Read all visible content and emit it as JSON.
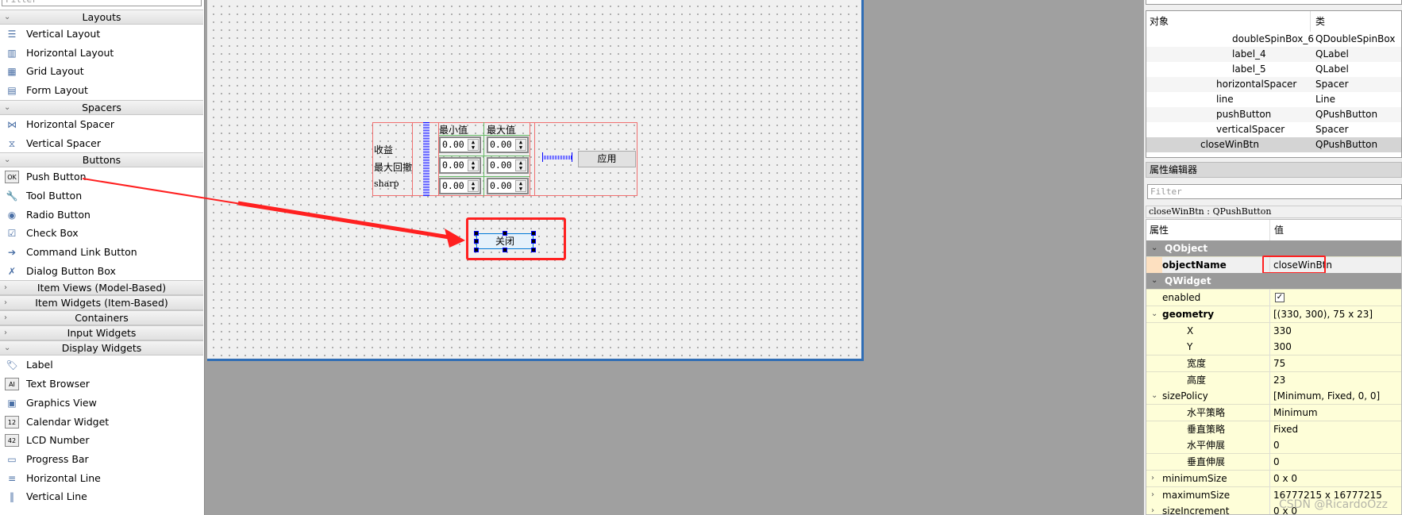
{
  "widget_box": {
    "filter_placeholder": "Filter",
    "categories": [
      {
        "label": "Layouts",
        "expanded": true,
        "items": [
          {
            "label": "Vertical Layout",
            "icon": "vertical-layout-icon"
          },
          {
            "label": "Horizontal Layout",
            "icon": "horizontal-layout-icon"
          },
          {
            "label": "Grid Layout",
            "icon": "grid-layout-icon"
          },
          {
            "label": "Form Layout",
            "icon": "form-layout-icon"
          }
        ]
      },
      {
        "label": "Spacers",
        "expanded": true,
        "items": [
          {
            "label": "Horizontal Spacer",
            "icon": "horizontal-spacer-icon"
          },
          {
            "label": "Vertical Spacer",
            "icon": "vertical-spacer-icon"
          }
        ]
      },
      {
        "label": "Buttons",
        "expanded": true,
        "items": [
          {
            "label": "Push Button",
            "icon": "push-button-icon",
            "glyph": "OK"
          },
          {
            "label": "Tool Button",
            "icon": "tool-button-icon"
          },
          {
            "label": "Radio Button",
            "icon": "radio-button-icon"
          },
          {
            "label": "Check Box",
            "icon": "check-box-icon"
          },
          {
            "label": "Command Link Button",
            "icon": "command-link-icon"
          },
          {
            "label": "Dialog Button Box",
            "icon": "dialog-button-box-icon"
          }
        ]
      },
      {
        "label": "Item Views (Model-Based)",
        "expanded": false,
        "items": []
      },
      {
        "label": "Item Widgets (Item-Based)",
        "expanded": false,
        "items": []
      },
      {
        "label": "Containers",
        "expanded": false,
        "items": []
      },
      {
        "label": "Input Widgets",
        "expanded": false,
        "items": []
      },
      {
        "label": "Display Widgets",
        "expanded": true,
        "items": [
          {
            "label": "Label",
            "icon": "label-icon"
          },
          {
            "label": "Text Browser",
            "icon": "text-browser-icon",
            "glyph": "AI"
          },
          {
            "label": "Graphics View",
            "icon": "graphics-view-icon"
          },
          {
            "label": "Calendar Widget",
            "icon": "calendar-icon",
            "glyph": "12"
          },
          {
            "label": "LCD Number",
            "icon": "lcd-number-icon",
            "glyph": "42"
          },
          {
            "label": "Progress Bar",
            "icon": "progress-bar-icon"
          },
          {
            "label": "Horizontal Line",
            "icon": "horizontal-line-icon"
          },
          {
            "label": "Vertical Line",
            "icon": "vertical-line-icon"
          }
        ]
      }
    ]
  },
  "form": {
    "row_labels": [
      "收益",
      "最大回撤",
      "sharp"
    ],
    "col_headers": [
      "最小值",
      "最大值"
    ],
    "spin_values": [
      [
        "0.00",
        "0.00"
      ],
      [
        "0.00",
        "0.00"
      ],
      [
        "0.00",
        "0.00"
      ]
    ],
    "apply_button": "应用",
    "close_button": "关闭"
  },
  "object_inspector": {
    "headers": [
      "对象",
      "类"
    ],
    "rows": [
      {
        "name": "doubleSpinBox_6",
        "class": "QDoubleSpinBox",
        "level": 3
      },
      {
        "name": "label_4",
        "class": "QLabel",
        "level": 3
      },
      {
        "name": "label_5",
        "class": "QLabel",
        "level": 3
      },
      {
        "name": "horizontalSpacer",
        "class": "Spacer",
        "level": 2
      },
      {
        "name": "line",
        "class": "Line",
        "level": 2
      },
      {
        "name": "pushButton",
        "class": "QPushButton",
        "level": 2
      },
      {
        "name": "verticalSpacer",
        "class": "Spacer",
        "level": 2
      },
      {
        "name": "closeWinBtn",
        "class": "QPushButton",
        "level": 1,
        "selected": true
      }
    ]
  },
  "property_editor": {
    "title": "属性编辑器",
    "filter_placeholder": "Filter",
    "object_label": "closeWinBtn : QPushButton",
    "headers": [
      "属性",
      "值"
    ],
    "rows": [
      {
        "type": "group",
        "key": "QObject"
      },
      {
        "key": "objectName",
        "value": "closeWinBtn",
        "bold": true,
        "level": 0,
        "highlight": true
      },
      {
        "type": "group",
        "key": "QWidget"
      },
      {
        "key": "enabled",
        "value": "",
        "checkbox": true,
        "checked": true,
        "level": 0
      },
      {
        "key": "geometry",
        "value": "[(330, 300), 75 x 23]",
        "bold": true,
        "level": 0,
        "expanded": true
      },
      {
        "key": "X",
        "value": "330",
        "level": 1
      },
      {
        "key": "Y",
        "value": "300",
        "level": 1
      },
      {
        "key": "宽度",
        "value": "75",
        "level": 1
      },
      {
        "key": "高度",
        "value": "23",
        "level": 1
      },
      {
        "key": "sizePolicy",
        "value": "[Minimum, Fixed, 0, 0]",
        "level": 0,
        "expanded": true
      },
      {
        "key": "水平策略",
        "value": "Minimum",
        "level": 1
      },
      {
        "key": "垂直策略",
        "value": "Fixed",
        "level": 1
      },
      {
        "key": "水平伸展",
        "value": "0",
        "level": 1
      },
      {
        "key": "垂直伸展",
        "value": "0",
        "level": 1
      },
      {
        "key": "minimumSize",
        "value": "0 x 0",
        "level": 0,
        "collapsed": true
      },
      {
        "key": "maximumSize",
        "value": "16777215 x 16777215",
        "level": 0,
        "collapsed": true
      },
      {
        "key": "sizeIncrement",
        "value": "0 x 0",
        "level": 0,
        "collapsed": true
      }
    ]
  },
  "watermark": "CSDN @RicardoOzz",
  "colors": {
    "annotation_red": "#ff2020",
    "selection_blue": "#0000ff",
    "property_yellow": "#fefed8",
    "group_gray": "#9a9a9a"
  }
}
